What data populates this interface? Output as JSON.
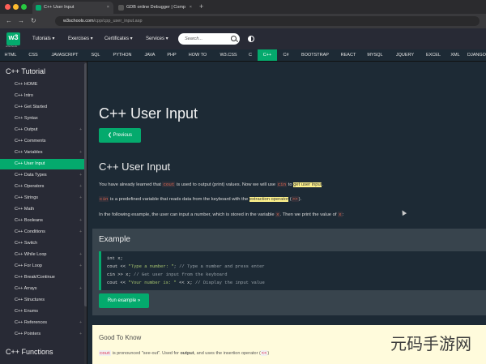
{
  "browser": {
    "tabs": [
      {
        "title": "C++ User Input",
        "active": true
      },
      {
        "title": "GDB online Debugger | Comp",
        "active": false
      }
    ],
    "new_tab": "+",
    "url_host": "w3schools.com",
    "url_path": "/cpp/cpp_user_input.asp",
    "back": "←",
    "forward": "→",
    "reload": "↻"
  },
  "topnav": {
    "logo": "w3",
    "logo_sub": "w3schools",
    "menus": [
      "Tutorials ▾",
      "Exercises ▾",
      "Certificates ▾",
      "Services ▾"
    ],
    "search_placeholder": "Search..."
  },
  "langbar": [
    "HTML",
    "CSS",
    "JAVASCRIPT",
    "SQL",
    "PYTHON",
    "JAVA",
    "PHP",
    "HOW TO",
    "W3.CSS",
    "C",
    "C++",
    "C#",
    "BOOTSTRAP",
    "REACT",
    "MYSQL",
    "JQUERY",
    "EXCEL",
    "XML",
    "DJANGO"
  ],
  "sidebar": {
    "heading": "C++ Tutorial",
    "items": [
      {
        "label": "C++ HOME",
        "plus": ""
      },
      {
        "label": "C++ Intro",
        "plus": ""
      },
      {
        "label": "C++ Get Started",
        "plus": ""
      },
      {
        "label": "C++ Syntax",
        "plus": ""
      },
      {
        "label": "C++ Output",
        "plus": "+"
      },
      {
        "label": "C++ Comments",
        "plus": ""
      },
      {
        "label": "C++ Variables",
        "plus": "+"
      },
      {
        "label": "C++ User Input",
        "plus": ""
      },
      {
        "label": "C++ Data Types",
        "plus": "+"
      },
      {
        "label": "C++ Operators",
        "plus": "+"
      },
      {
        "label": "C++ Strings",
        "plus": "+"
      },
      {
        "label": "C++ Math",
        "plus": ""
      },
      {
        "label": "C++ Booleans",
        "plus": "+"
      },
      {
        "label": "C++ Conditions",
        "plus": "+"
      },
      {
        "label": "C++ Switch",
        "plus": ""
      },
      {
        "label": "C++ While Loop",
        "plus": "+"
      },
      {
        "label": "C++ For Loop",
        "plus": "+"
      },
      {
        "label": "C++ Break/Continue",
        "plus": ""
      },
      {
        "label": "C++ Arrays",
        "plus": "+"
      },
      {
        "label": "C++ Structures",
        "plus": ""
      },
      {
        "label": "C++ Enums",
        "plus": ""
      },
      {
        "label": "C++ References",
        "plus": "+"
      },
      {
        "label": "C++ Pointers",
        "plus": "+"
      }
    ],
    "heading2": "C++ Functions"
  },
  "main": {
    "title": "C++ User Input",
    "prev_button": "❮ Previous",
    "section_title": "C++ User Input",
    "p1_a": "You have already learned that ",
    "p1_code1": "cout",
    "p1_b": " is used to output (print) values. Now we will use ",
    "p1_code2": "cin",
    "p1_c": " to ",
    "p1_hl": "get user input",
    "p1_d": ".",
    "p2_code": "cin",
    "p2_a": " is a predefined variable that reads data from the keyboard with the ",
    "p2_hl": "extraction operator",
    "p2_b": " (",
    "p2_code2": ">>",
    "p2_c": ").",
    "p3_a": "In the following example, the user can input a number, which is stored in the variable ",
    "p3_code1": "x",
    "p3_b": ". Then we print the value of ",
    "p3_code2": "x",
    "p3_c": ":",
    "example_title": "Example",
    "code_line1": "int x;",
    "code_line2_kw": "cout << ",
    "code_line2_str": "\"Type a number: \"",
    "code_line2_cm": "; // Type a number and press enter",
    "code_line3_kw": "cin >> x; ",
    "code_line3_cm": "// Get user input from the keyboard",
    "code_line4_kw": "cout << ",
    "code_line4_str": "\"Your number is: \"",
    "code_line4_b": " << x; ",
    "code_line4_cm": "// Display the input value",
    "run_button": "Run example »",
    "note_title": "Good To Know",
    "note_code": "cout",
    "note_a": " is pronounced \"see-out\". Used for ",
    "note_b1": "output",
    "note_b": ", and uses the insertion operator (",
    "note_code2": "<<",
    "note_c": ")"
  },
  "watermark": "元码手游网",
  "colors": {
    "accent": "#04aa6d",
    "bg": "#1d2a35",
    "nav": "#282a35",
    "highlight": "#fff38c"
  }
}
